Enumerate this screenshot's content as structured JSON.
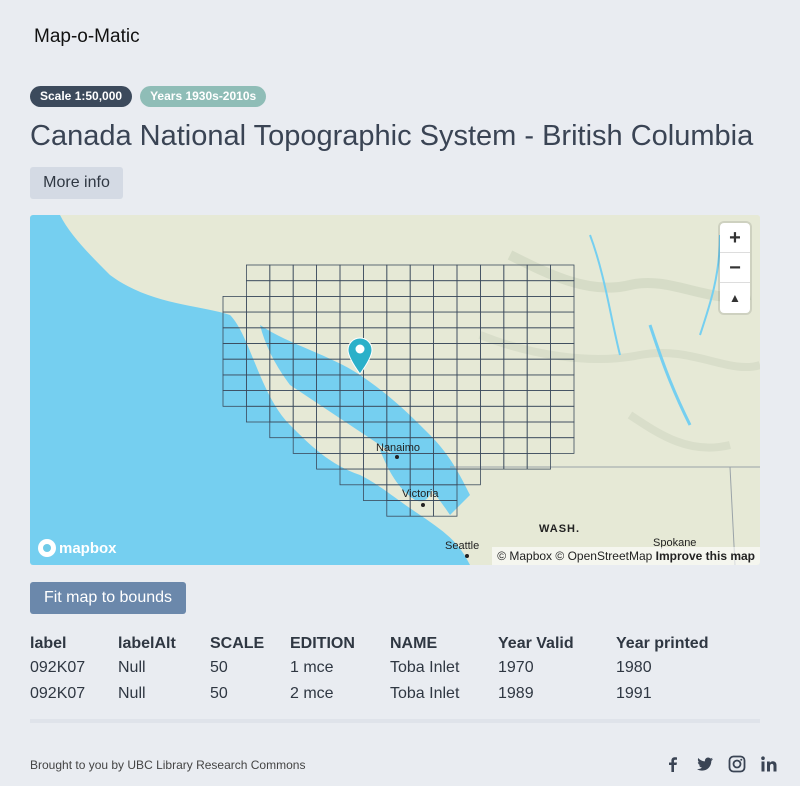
{
  "brand": "Map-o-Matic",
  "badges": {
    "scale": "Scale 1:50,000",
    "years": "Years 1930s-2010s"
  },
  "title": "Canada National Topographic System - British Columbia",
  "more_info_label": "More info",
  "map": {
    "zoom_in": "+",
    "zoom_out": "−",
    "compass": "▲",
    "logo": "mapbox",
    "attribution": {
      "mapbox": "© Mapbox",
      "osm": "© OpenStreetMap",
      "improve": "Improve this map"
    },
    "places": {
      "nanaimo": "Nanaimo",
      "victoria": "Victoria",
      "seattle": "Seattle",
      "wash": "WASH.",
      "spokane": "Spokane"
    },
    "colors": {
      "water": "#75cff0",
      "land": "#e6e9d6",
      "grid": "#3b4a5c",
      "marker": "#2bb0c9"
    }
  },
  "fit_button_label": "Fit map to bounds",
  "table": {
    "headers": [
      "label",
      "labelAlt",
      "SCALE",
      "EDITION",
      "NAME",
      "Year Valid",
      "Year printed"
    ],
    "rows": [
      [
        "092K07",
        "Null",
        "50",
        "1 mce",
        "Toba Inlet",
        "1970",
        "1980"
      ],
      [
        "092K07",
        "Null",
        "50",
        "2 mce",
        "Toba Inlet",
        "1989",
        "1991"
      ]
    ]
  },
  "footer": {
    "credit": "Brought to you by UBC Library Research Commons",
    "socials": [
      "facebook-icon",
      "twitter-icon",
      "instagram-icon",
      "linkedin-icon"
    ]
  }
}
